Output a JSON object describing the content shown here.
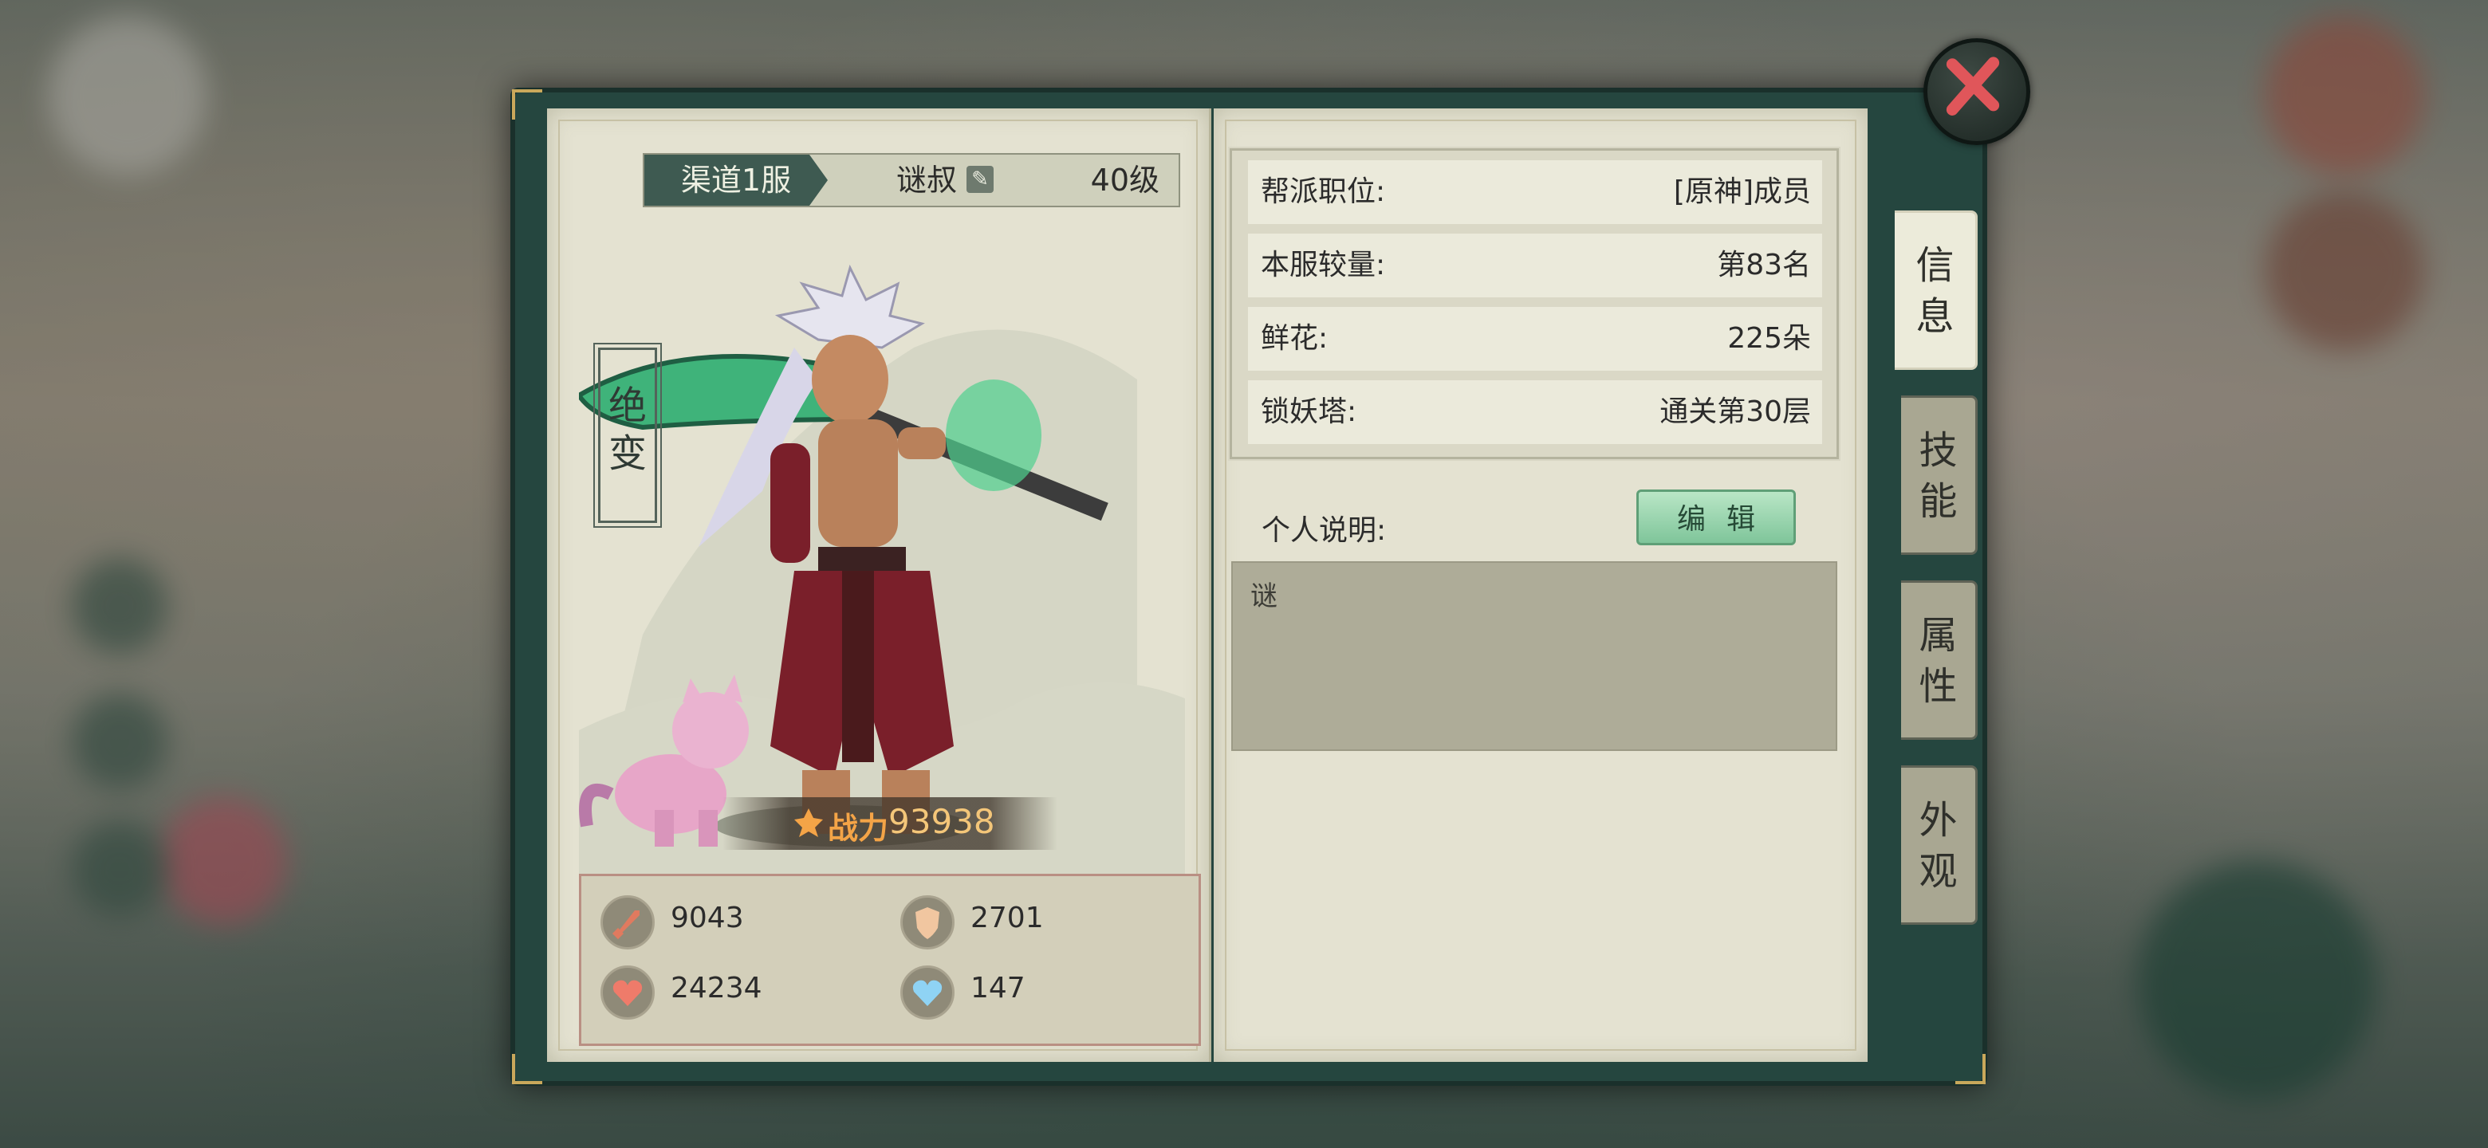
{
  "header": {
    "server": "渠道1服",
    "player_name": "谜叔",
    "level": "40级"
  },
  "character": {
    "title_seal": "绝变",
    "power_label": "战力",
    "power_value": "93938"
  },
  "stats": [
    {
      "icon": "sword-icon",
      "value": "9043"
    },
    {
      "icon": "shield-icon",
      "value": "2701"
    },
    {
      "icon": "heart-icon",
      "value": "24234"
    },
    {
      "icon": "mana-heart-icon",
      "value": "147"
    }
  ],
  "info": [
    {
      "label": "帮派职位:",
      "value": "[原神]成员"
    },
    {
      "label": "本服较量:",
      "value": "第83名"
    },
    {
      "label": "鲜花:",
      "value": "225朵"
    },
    {
      "label": "锁妖塔:",
      "value": "通关第30层"
    }
  ],
  "description": {
    "label": "个人说明:",
    "edit_button": "编辑",
    "text": "谜"
  },
  "tabs": [
    {
      "label": "信息",
      "active": true
    },
    {
      "label": "技能",
      "active": false
    },
    {
      "label": "属性",
      "active": false
    },
    {
      "label": "外观",
      "active": false
    }
  ],
  "colors": {
    "book_frame": "#25463f",
    "page": "#e4e2d1",
    "accent_green": "#7fc59a",
    "power_orange": "#f4a447",
    "close_red": "#e0565a"
  }
}
